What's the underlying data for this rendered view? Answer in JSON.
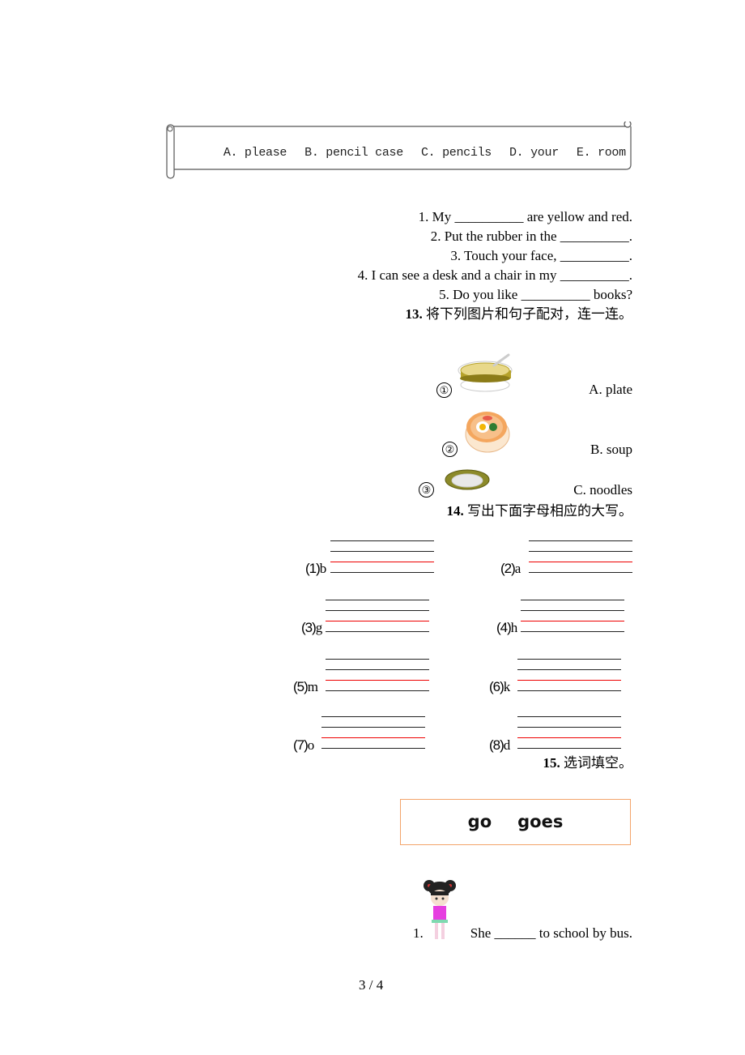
{
  "word_bank": {
    "options": [
      "A. please",
      "B. pencil case",
      "C. pencils",
      "D. your",
      "E. room"
    ]
  },
  "fill_in": {
    "sentences": [
      "1. My __________ are yellow and red.",
      "2. Put the rubber in the __________.",
      "3. Touch your face, __________.",
      "4. I can see a desk and a chair in my __________.",
      "5. Do you like __________ books?"
    ]
  },
  "q13": {
    "number": "13.",
    "instruction": "将下列图片和句子配对，连一连。",
    "pictures": [
      {
        "marker": "①",
        "icon": "noodles-bowl-icon"
      },
      {
        "marker": "②",
        "icon": "soup-bowl-icon"
      },
      {
        "marker": "③",
        "icon": "plate-icon"
      }
    ],
    "options": [
      "A. plate",
      "B. soup",
      "C. noodles"
    ]
  },
  "q14": {
    "number": "14.",
    "instruction": "写出下面字母相应的大写。",
    "items": [
      {
        "num": "(1)",
        "letter": "b"
      },
      {
        "num": "(2)",
        "letter": "a"
      },
      {
        "num": "(3)",
        "letter": "g"
      },
      {
        "num": "(4)",
        "letter": "h"
      },
      {
        "num": "(5)",
        "letter": "m"
      },
      {
        "num": "(6)",
        "letter": "k"
      },
      {
        "num": "(7)",
        "letter": "o"
      },
      {
        "num": "(8)",
        "letter": "d"
      }
    ]
  },
  "q15": {
    "number": "15.",
    "instruction": "选词填空。",
    "words": [
      "go",
      "goes"
    ],
    "box_border_color": "#f3a46a",
    "sentence": {
      "num": "1.",
      "icon": "girl-icon",
      "text": "She ______ to school by bus."
    }
  },
  "footer": {
    "page": "3 / 4"
  }
}
